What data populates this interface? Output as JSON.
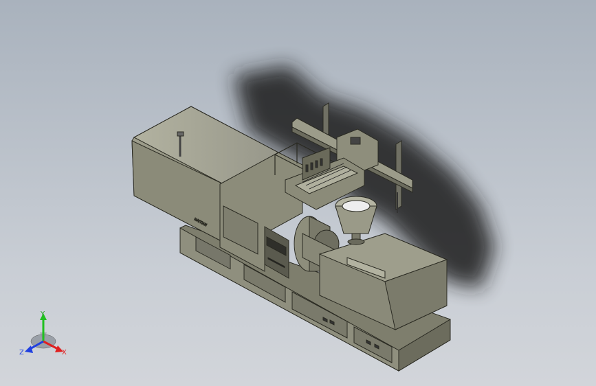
{
  "colors": {
    "background_top": "#a9b2bd",
    "background_bottom": "#d2d5da",
    "machine_body": "#8a8a78",
    "machine_light": "#9c9c8a",
    "machine_dark": "#6e6e5e",
    "outline": "#2a2a22",
    "shadow": "#1e1e1e",
    "axis_x": "#e02020",
    "axis_y": "#20c020",
    "axis_z": "#2040e0"
  },
  "scene": {
    "subject": "injection-molding-machine",
    "robot_arm": "gantry-robot",
    "hopper": "material-hopper"
  },
  "triad": {
    "x_label": "X",
    "y_label": "Y",
    "z_label": "Z"
  }
}
